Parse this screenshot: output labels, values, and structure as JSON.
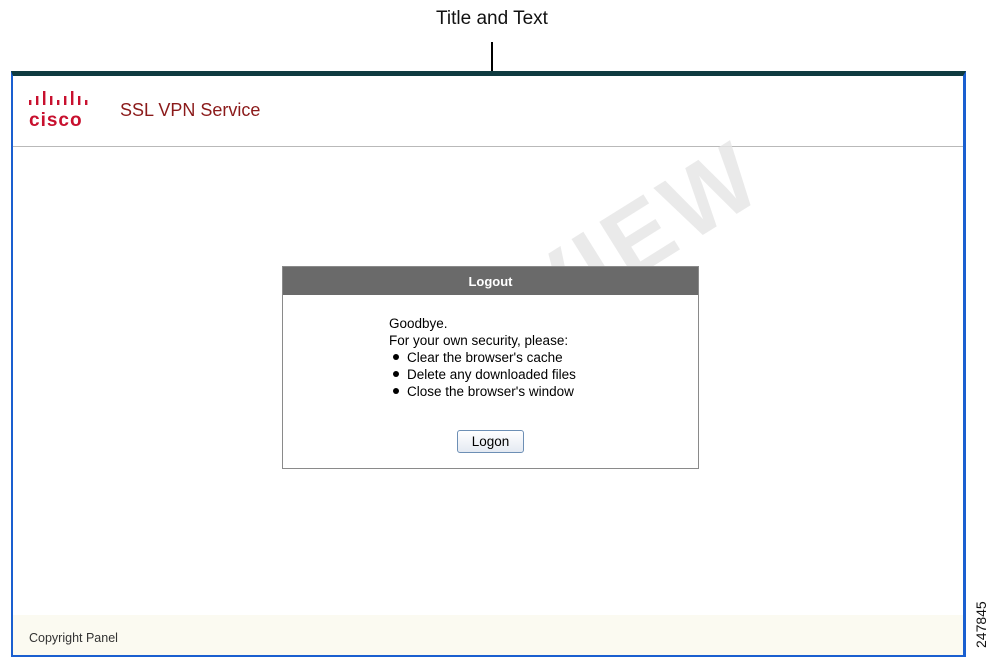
{
  "callout": {
    "label": "Title and Text"
  },
  "header": {
    "brand": "cisco",
    "service_title": "SSL VPN Service"
  },
  "dialog": {
    "title": "Logout",
    "greeting": "Goodbye.",
    "instruction": "For your own security, please:",
    "items": [
      "Clear the browser's cache",
      "Delete any downloaded files",
      "Close the browser's window"
    ],
    "button_label": "Logon"
  },
  "watermark": "PREVIEW",
  "footer": {
    "copyright": "Copyright Panel"
  },
  "figure_id": "247845",
  "colors": {
    "frame_border": "#1a5fd0",
    "frame_top": "#0f3b40",
    "title_text": "#8b1a1a",
    "dialog_header": "#6a6a6a",
    "footer_bg": "#fbfaf1",
    "logo": "#c8102e"
  }
}
